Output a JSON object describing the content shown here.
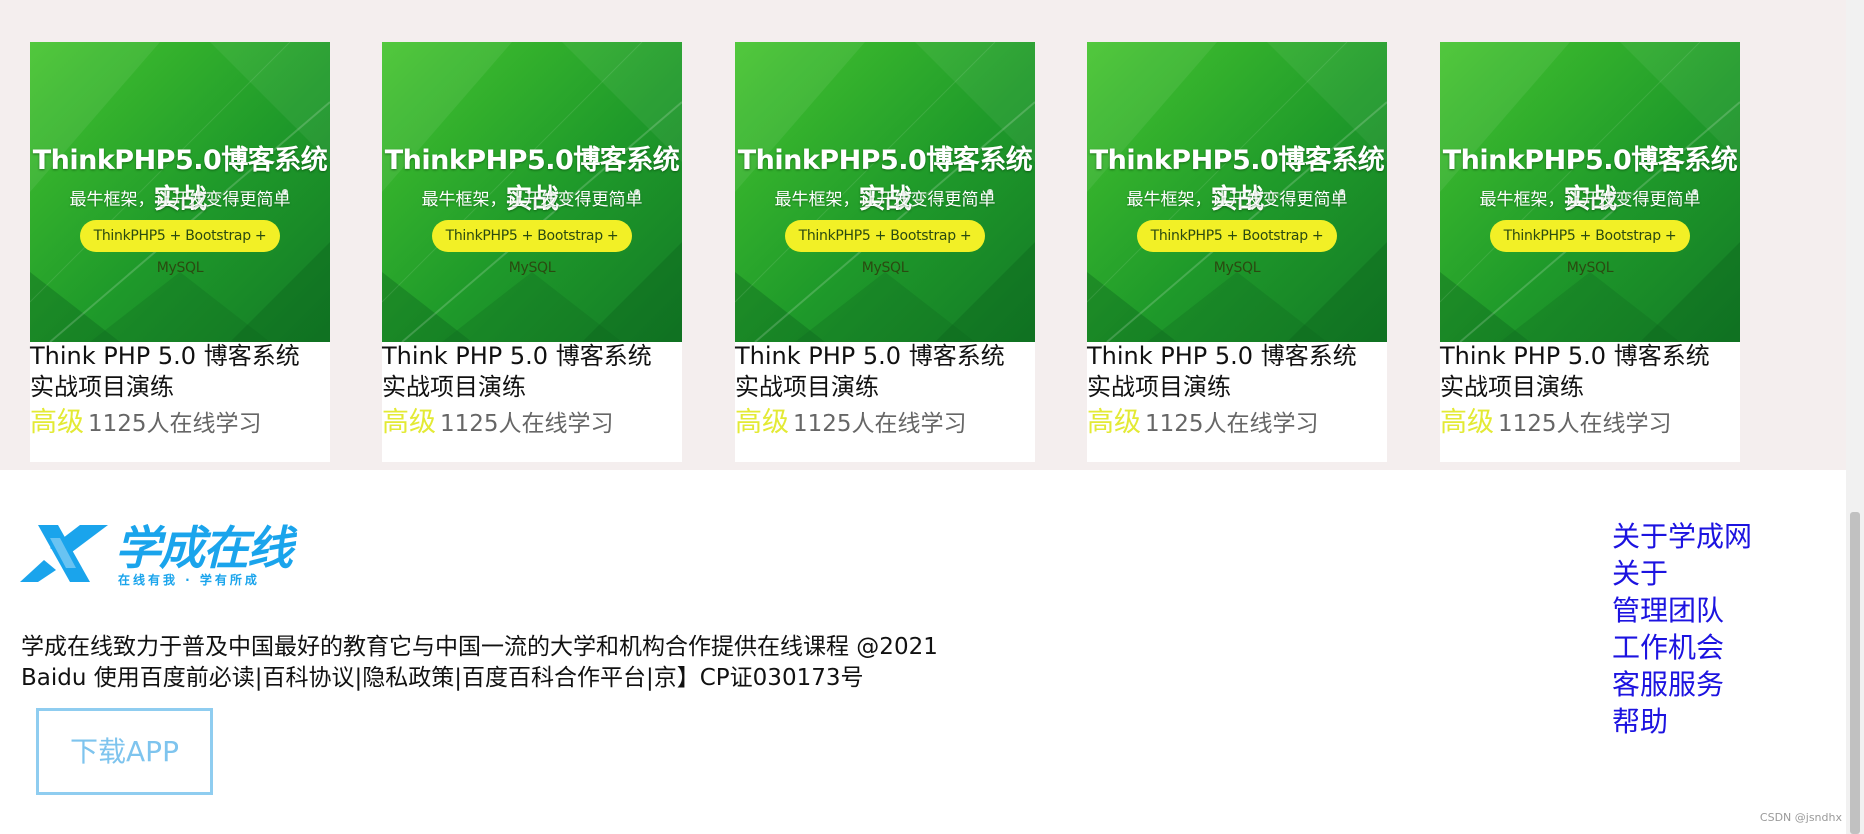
{
  "courses": [
    {
      "image_title": "ThinkPHP5.0博客系统实战",
      "image_subtitle": "最牛框架，让开发变得更简单",
      "image_tag": "ThinkPHP5 + Bootstrap + MySQL",
      "title": "Think PHP 5.0 博客系统 实战项目演练",
      "level": "高级",
      "learners": "1125人在线学习"
    },
    {
      "image_title": "ThinkPHP5.0博客系统实战",
      "image_subtitle": "最牛框架，让开发变得更简单",
      "image_tag": "ThinkPHP5 + Bootstrap + MySQL",
      "title": "Think PHP 5.0 博客系统 实战项目演练",
      "level": "高级",
      "learners": "1125人在线学习"
    },
    {
      "image_title": "ThinkPHP5.0博客系统实战",
      "image_subtitle": "最牛框架，让开发变得更简单",
      "image_tag": "ThinkPHP5 + Bootstrap + MySQL",
      "title": "Think PHP 5.0 博客系统 实战项目演练",
      "level": "高级",
      "learners": "1125人在线学习"
    },
    {
      "image_title": "ThinkPHP5.0博客系统实战",
      "image_subtitle": "最牛框架，让开发变得更简单",
      "image_tag": "ThinkPHP5 + Bootstrap + MySQL",
      "title": "Think PHP 5.0 博客系统 实战项目演练",
      "level": "高级",
      "learners": "1125人在线学习"
    },
    {
      "image_title": "ThinkPHP5.0博客系统实战",
      "image_subtitle": "最牛框架，让开发变得更简单",
      "image_tag": "ThinkPHP5 + Bootstrap + MySQL",
      "title": "Think PHP 5.0 博客系统 实战项目演练",
      "level": "高级",
      "learners": "1125人在线学习"
    }
  ],
  "footer": {
    "logo_text": "学成在线",
    "logo_slogan": "在线有我 · 学有所成",
    "description_line1": "学成在线致力于普及中国最好的教育它与中国一流的大学和机构合作提供在线课程 @2021",
    "description_line2": "Baidu 使用百度前必读|百科协议|隐私政策|百度百科合作平台|京】CP证030173号",
    "download_app": "下载APP",
    "links": [
      "关于学成网",
      "关于",
      "管理团队",
      "工作机会",
      "客服服务",
      "帮助"
    ]
  },
  "watermark": "CSDN @jsndhx",
  "colors": {
    "level": "#e3ea35",
    "link": "#1c13e0",
    "brand": "#1aa4ec",
    "section_bg": "#f4eeee",
    "thumb_green": "#1f9a2a"
  }
}
